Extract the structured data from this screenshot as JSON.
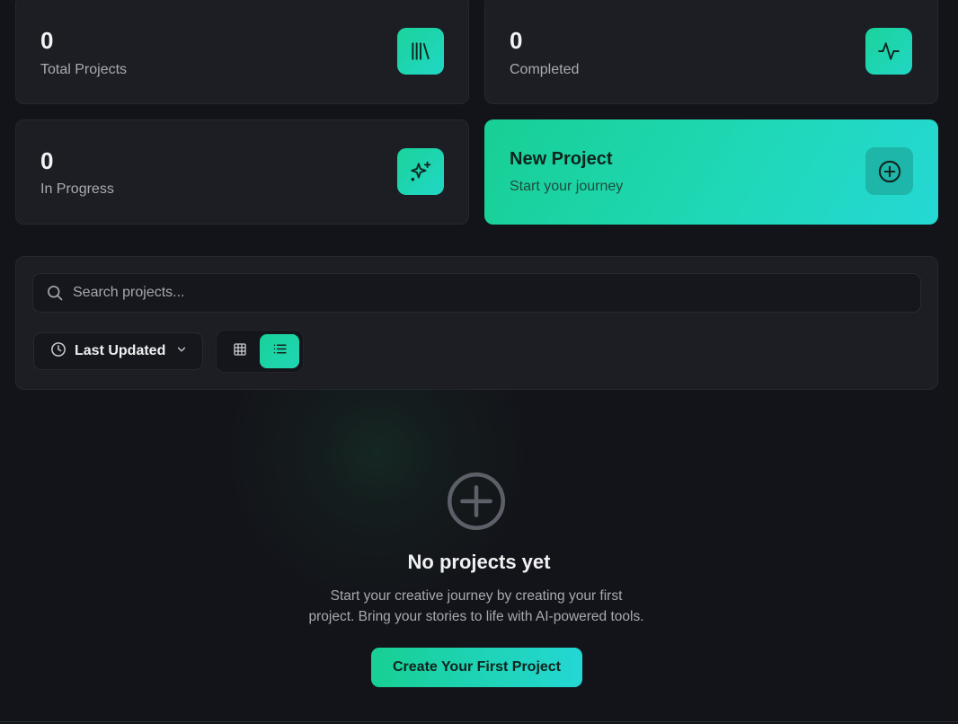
{
  "stats": {
    "total": {
      "value": "0",
      "label": "Total Projects",
      "icon": "library-icon"
    },
    "completed": {
      "value": "0",
      "label": "Completed",
      "icon": "activity-icon"
    },
    "in_progress": {
      "value": "0",
      "label": "In Progress",
      "icon": "sparkles-icon"
    }
  },
  "new_project": {
    "title": "New Project",
    "subtitle": "Start your journey",
    "icon": "plus-circle-icon"
  },
  "toolbar": {
    "search_placeholder": "Search projects...",
    "sort_label": "Last Updated",
    "sort_icon": "clock-icon",
    "views": [
      {
        "name": "grid",
        "icon": "grid-icon",
        "active": false
      },
      {
        "name": "list",
        "icon": "list-icon",
        "active": true
      }
    ]
  },
  "empty_state": {
    "icon": "plus-circle-icon",
    "title": "No projects yet",
    "description": "Start your creative journey by creating your first project. Bring your stories to life with AI-powered tools.",
    "cta_label": "Create Your First Project"
  },
  "colors": {
    "accent_start": "#18cf94",
    "accent_end": "#24d7d4",
    "background": "#131419",
    "card": "#1c1e24"
  }
}
